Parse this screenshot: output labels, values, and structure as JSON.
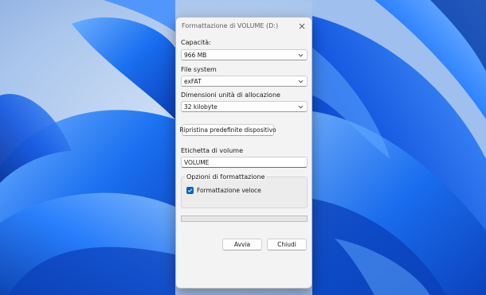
{
  "window": {
    "title": "Formattazione di VOLUME (D:)"
  },
  "capacity": {
    "label": "Capacità:",
    "value": "966 MB"
  },
  "file_system": {
    "label": "File system",
    "value": "exFAT"
  },
  "allocation": {
    "label": "Dimensioni unità di allocazione",
    "value": "32 kilobyte"
  },
  "restore_button": "Ripristina predefinite dispositivo",
  "volume_label": {
    "label": "Etichetta di volume",
    "value": "VOLUME"
  },
  "format_options": {
    "title": "Opzioni di formattazione",
    "quick_format_label": "Formattazione veloce",
    "quick_format_checked": true
  },
  "progress": {
    "value": 0
  },
  "buttons": {
    "start": "Avvia",
    "close": "Chiudi"
  },
  "colors": {
    "accent": "#0067c0",
    "wallpaper_blue": "#1565e8",
    "dialog_bg": "#f3f3f3"
  },
  "icons": {
    "close": "close-icon",
    "chevron": "chevron-down-icon",
    "check": "checkmark-icon"
  }
}
